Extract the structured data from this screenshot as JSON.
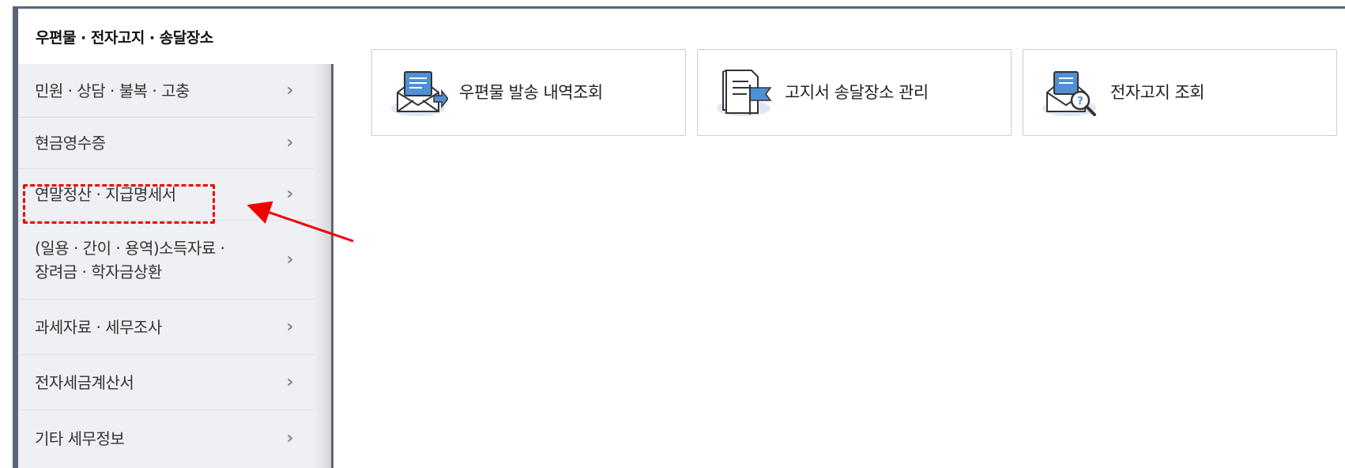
{
  "sidebar": {
    "header": "우편물 · 전자고지 · 송달장소",
    "items": [
      {
        "label": "민원 · 상담 · 불복 · 고충"
      },
      {
        "label": "현금영수증"
      },
      {
        "label": "연말정산 · 지급명세서"
      },
      {
        "label": "(일용 · 간이 · 용역)소득자료 ·\n장려금 · 학자금상환"
      },
      {
        "label": "과세자료 · 세무조사"
      },
      {
        "label": "전자세금계산서"
      },
      {
        "label": "기타 세무정보"
      }
    ],
    "chevron_icon": "chevron-right-icon",
    "highlighted_item": "연말정산 · 지급명세서"
  },
  "cards": [
    {
      "label": "우편물 발송 내역조회",
      "icon": "mail-send-icon"
    },
    {
      "label": "고지서 송달장소 관리",
      "icon": "document-flag-icon"
    },
    {
      "label": "전자고지 조회",
      "icon": "mail-search-icon"
    }
  ],
  "colors": {
    "sidebar_accent": "#5a6478",
    "sidebar_bg": "#eef0f4",
    "highlight": "#ee0000",
    "icon_blue": "#4f8fd6"
  }
}
